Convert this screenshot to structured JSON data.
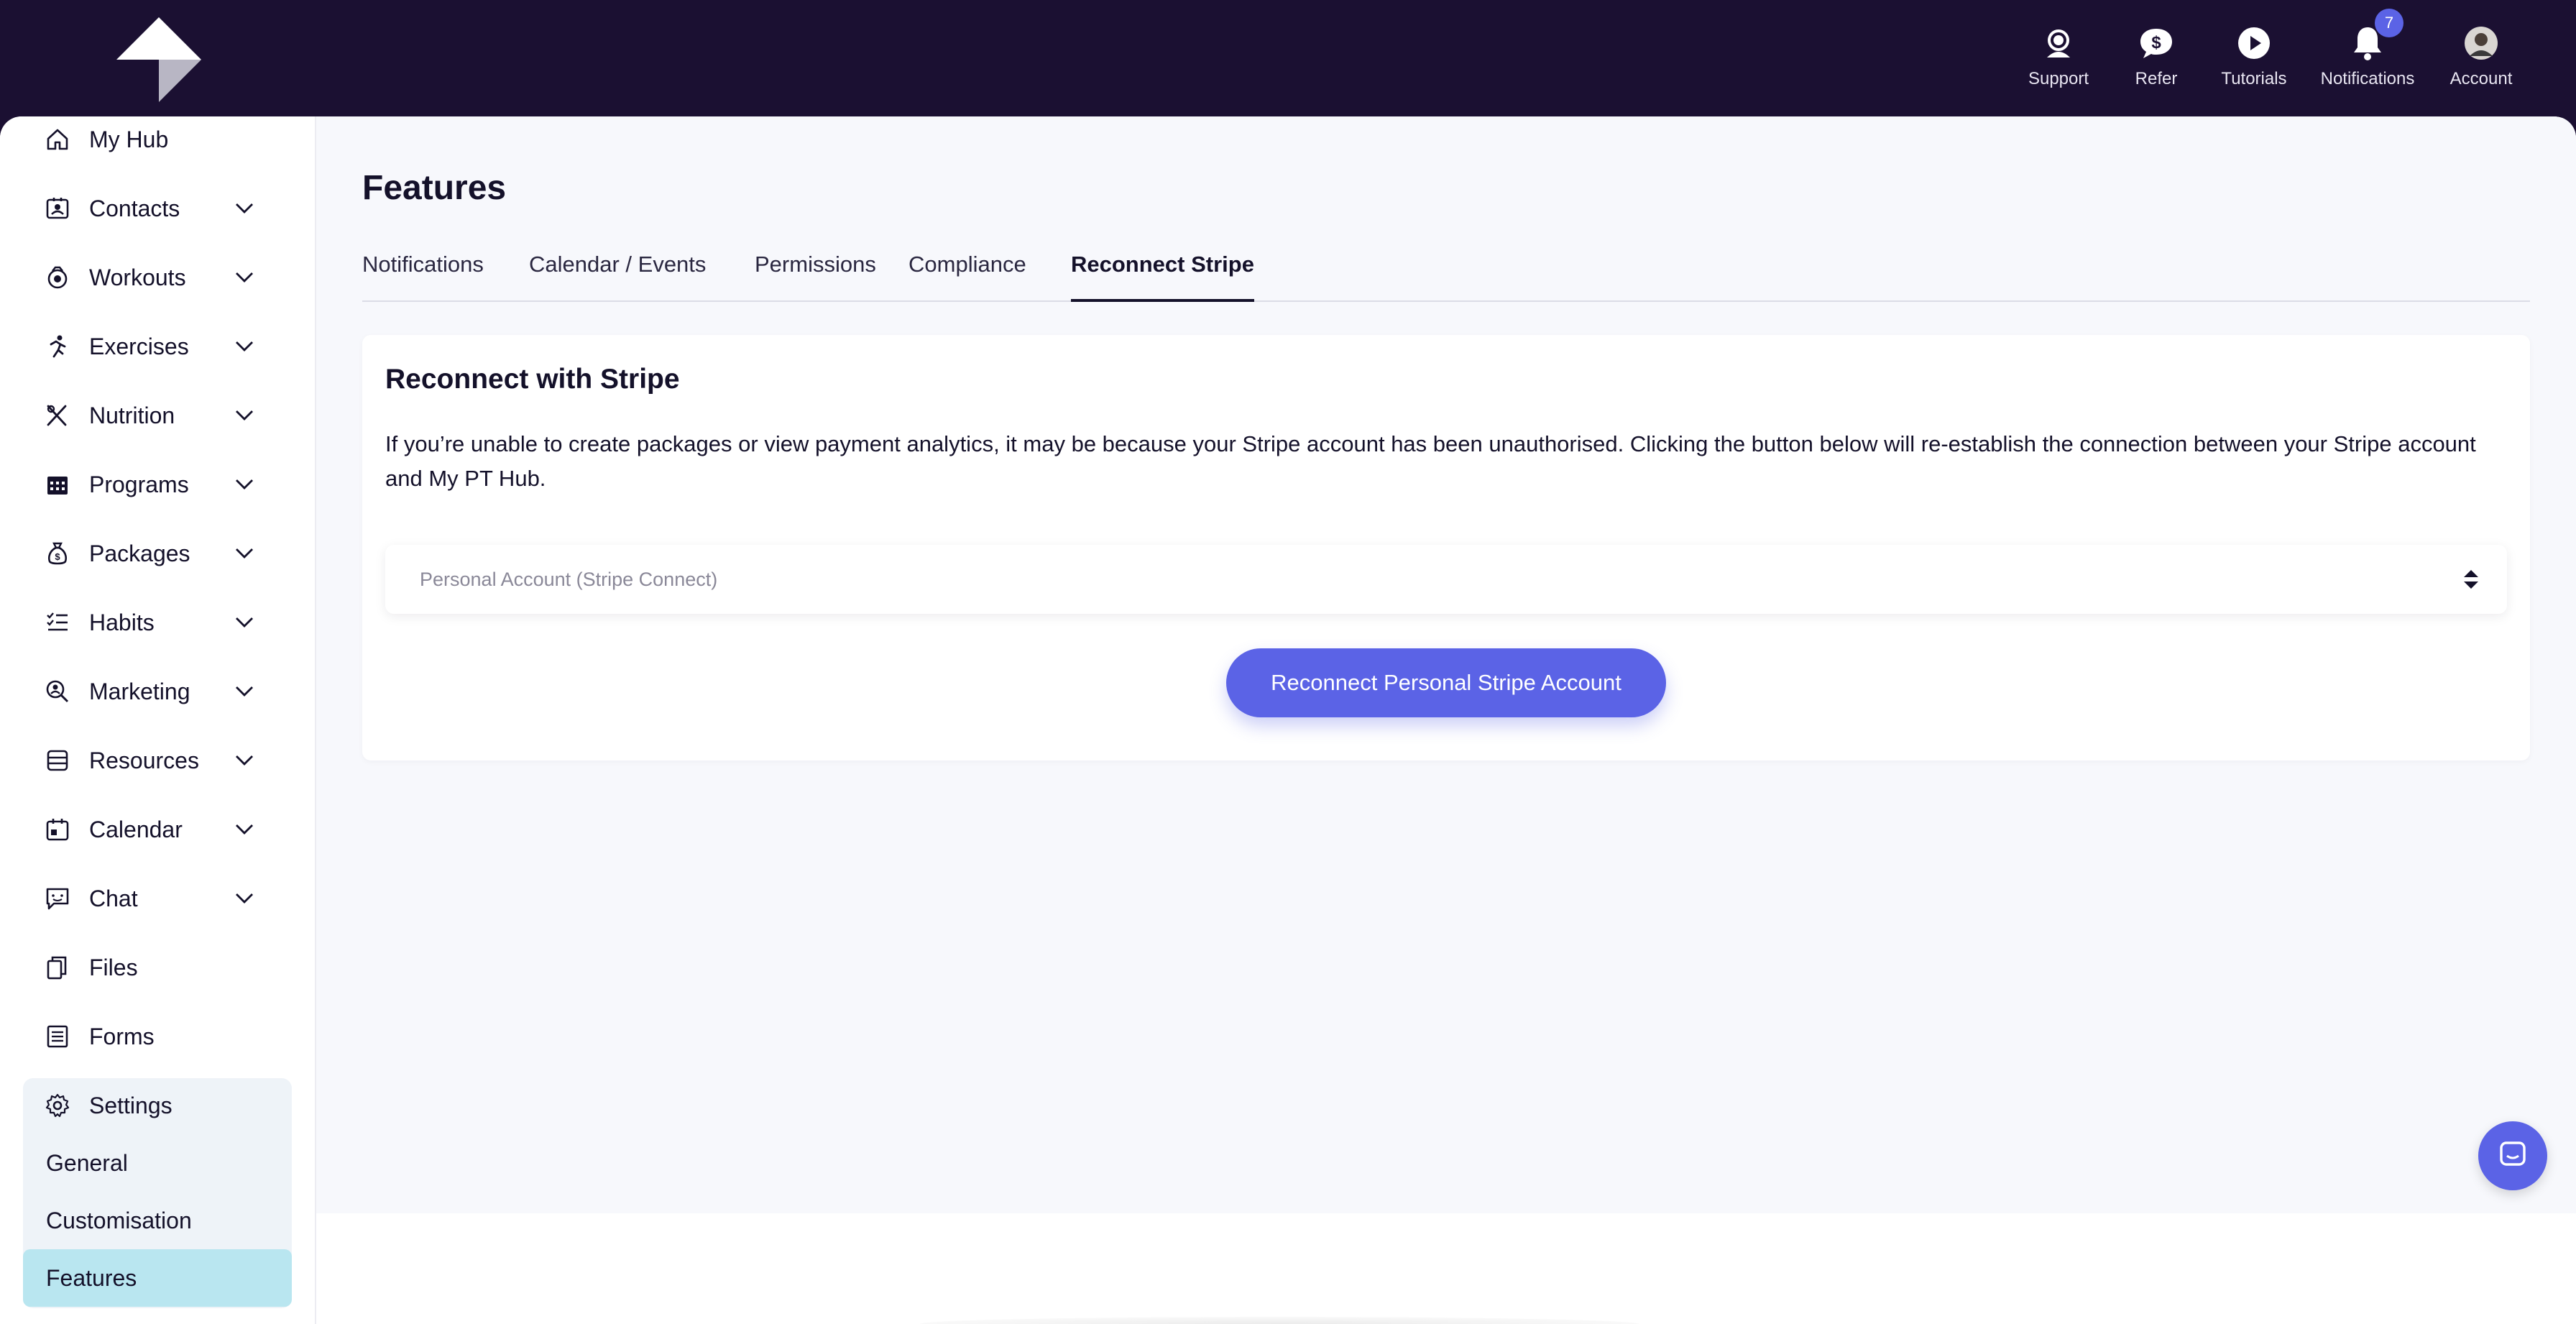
{
  "header": {
    "nav": [
      {
        "label": "Support",
        "icon": "support-headset-icon"
      },
      {
        "label": "Refer",
        "icon": "dollar-chat-icon"
      },
      {
        "label": "Tutorials",
        "icon": "play-icon"
      },
      {
        "label": "Notifications",
        "icon": "bell-icon",
        "badge": "7"
      },
      {
        "label": "Account",
        "icon": "avatar"
      }
    ]
  },
  "sidebar": {
    "items": [
      {
        "label": "My Hub",
        "icon": "home-icon"
      },
      {
        "label": "Contacts",
        "icon": "contacts-icon"
      },
      {
        "label": "Workouts",
        "icon": "workouts-icon"
      },
      {
        "label": "Exercises",
        "icon": "running-icon"
      },
      {
        "label": "Nutrition",
        "icon": "utensils-icon"
      },
      {
        "label": "Programs",
        "icon": "calendar-grid-icon"
      },
      {
        "label": "Packages",
        "icon": "money-bag-icon"
      },
      {
        "label": "Habits",
        "icon": "checklist-icon"
      },
      {
        "label": "Marketing",
        "icon": "search-person-icon"
      },
      {
        "label": "Resources",
        "icon": "database-icon"
      },
      {
        "label": "Calendar",
        "icon": "calendar-icon"
      },
      {
        "label": "Chat",
        "icon": "chat-icon"
      },
      {
        "label": "Files",
        "icon": "files-icon"
      },
      {
        "label": "Forms",
        "icon": "forms-icon"
      }
    ],
    "settings": {
      "label": "Settings",
      "icon": "gear-icon",
      "sub_items": [
        "General",
        "Customisation",
        "Features"
      ],
      "active": "Features"
    }
  },
  "main": {
    "title": "Features",
    "tabs": [
      "Notifications",
      "Calendar / Events",
      "Permissions",
      "Compliance",
      "Reconnect Stripe"
    ],
    "active_tab": "Reconnect Stripe",
    "card": {
      "title": "Reconnect with Stripe",
      "description": "If you’re unable to create packages or view payment analytics, it may be because your Stripe account has been unauthorised. Clicking the button below will re-establish the connection between your Stripe account and My PT Hub.",
      "select_value": "Personal Account (Stripe Connect)",
      "button_label": "Reconnect Personal Stripe Account"
    }
  },
  "colors": {
    "topbar": "#1b1032",
    "accent": "#5b63e6",
    "active_sub_item": "#b9e6f0",
    "main_bg": "#f7f8fc"
  }
}
